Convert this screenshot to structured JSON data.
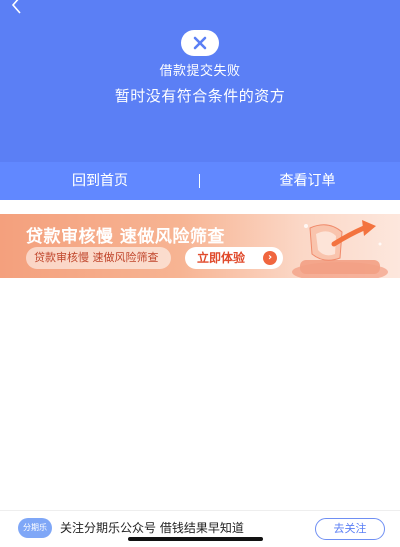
{
  "header": {
    "back_icon": "chevron-left-icon",
    "status_icon": "close-icon",
    "status_title": "借款提交失败",
    "status_desc": "暂时没有符合条件的资方"
  },
  "actions": {
    "home_label": "回到首页",
    "order_label": "查看订单"
  },
  "banner": {
    "title": "贷款审核慢  速做风险筛查",
    "subtitle": "贷款审核慢  速做风险筛查",
    "cta_label": "立即体验",
    "cta_icon": "chevron-right-icon"
  },
  "follow_bar": {
    "brand_logo_text": "分期乐",
    "text": "关注分期乐公众号  借钱结果早知道",
    "button_label": "去关注"
  },
  "colors": {
    "primary": "#5b7ff5",
    "banner_accent": "#e04a2c",
    "follow_accent": "#6f8ff3"
  }
}
